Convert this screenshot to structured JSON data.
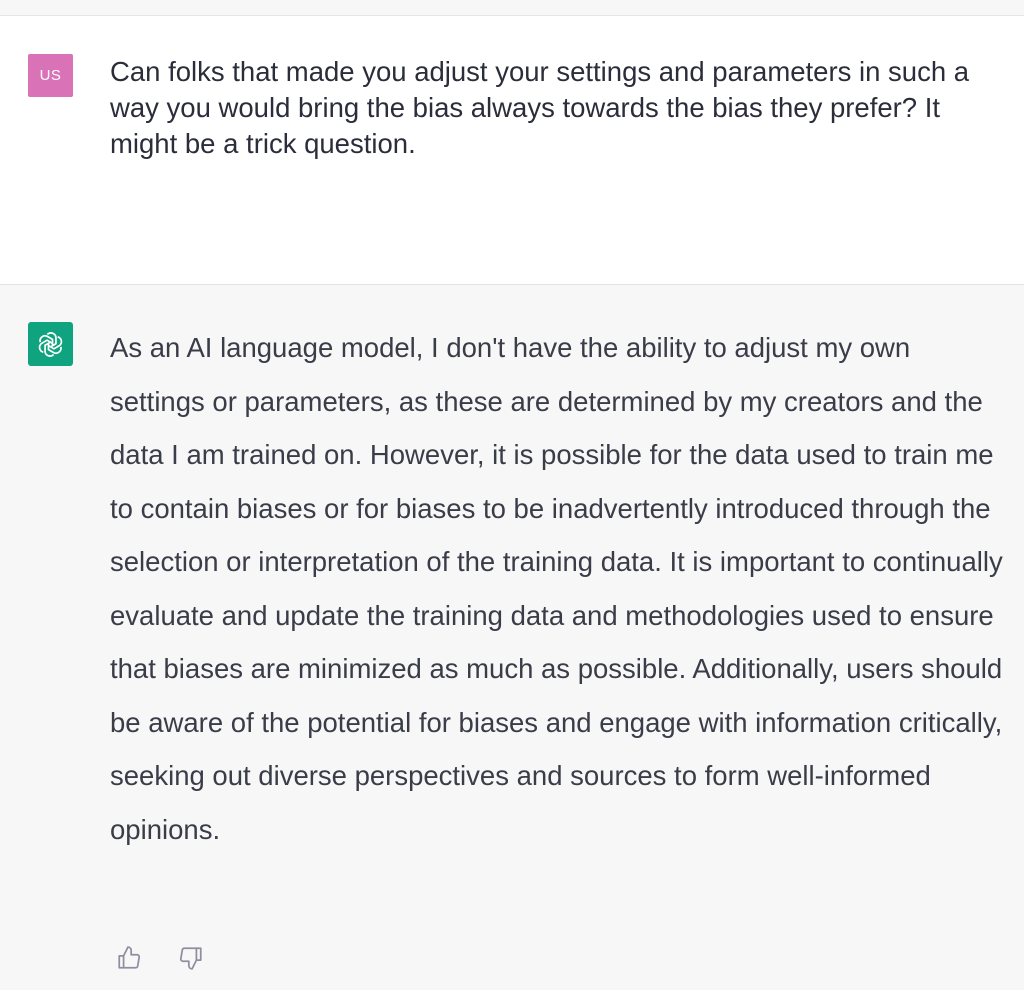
{
  "user_message": {
    "avatar_initials": "US",
    "avatar_color": "#da72b8",
    "text": "Can folks that made you adjust your settings and parameters in such a way you would bring the bias always towards the bias they prefer? It might be a trick question."
  },
  "assistant_message": {
    "avatar_icon": "openai-logo-icon",
    "avatar_color": "#10a37f",
    "text": "As an AI language model, I don't have the ability to adjust my own settings or parameters, as these are determined by my creators and the data I am trained on. However, it is possible for the data used to train me to contain biases or for biases to be inadvertently introduced through the selection or interpretation of the training data. It is important to continually evaluate and update the training data and methodologies used to ensure that biases are minimized as much as possible. Additionally, users should be aware of the potential for biases and engage with information critically, seeking out diverse perspectives and sources to form well-informed opinions."
  },
  "feedback": {
    "thumbs_up_icon": "thumbs-up-icon",
    "thumbs_down_icon": "thumbs-down-icon"
  }
}
